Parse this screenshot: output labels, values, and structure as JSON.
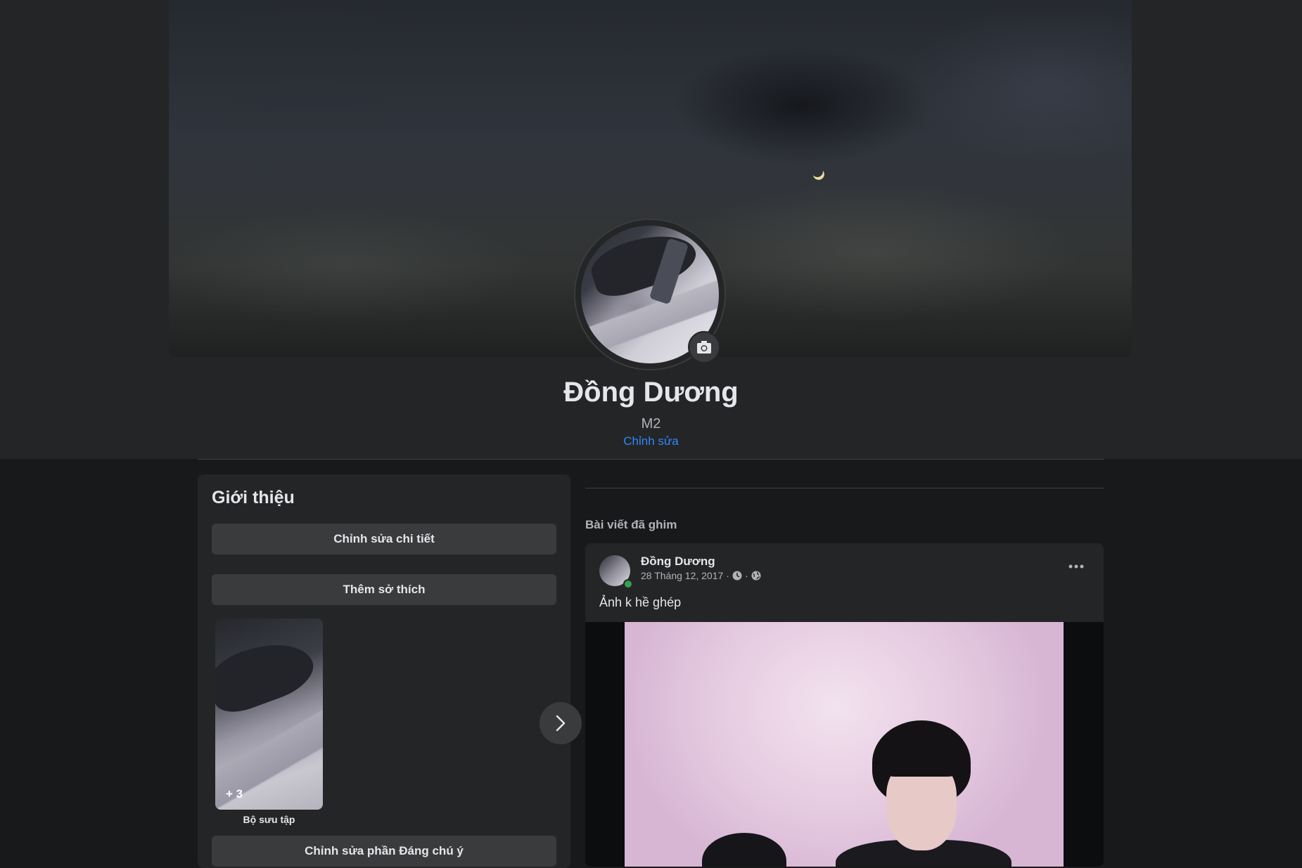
{
  "profile": {
    "name": "Đồng Dương",
    "subtitle": "M2",
    "edit_link": "Chỉnh sửa",
    "cover_icon": "camera-icon"
  },
  "intro": {
    "title": "Giới thiệu",
    "edit_details": "Chỉnh sửa chi tiết",
    "add_hobbies": "Thêm sở thích",
    "collection_count": "+ 3",
    "collection_label": "Bộ sưu tập",
    "edit_featured": "Chỉnh sửa phần Đáng chú ý"
  },
  "pinned": {
    "label": "Bài viết đã ghim",
    "post": {
      "author": "Đồng Dương",
      "date": "28 Tháng 12, 2017",
      "separator": "·",
      "text": "Ảnh k hề ghép"
    }
  },
  "colors": {
    "background": "#18191a",
    "card": "#242526",
    "button": "#3a3b3c",
    "accent_link": "#2d88ff",
    "online": "#31a24c"
  }
}
